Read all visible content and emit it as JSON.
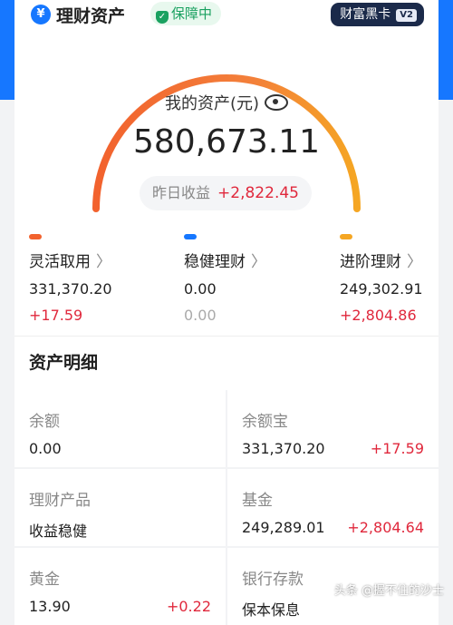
{
  "header": {
    "title": "理财资产",
    "badge": "保障中",
    "vip_label": "财富黑卡",
    "vip_tag": "V2",
    "yen": "¥"
  },
  "summary": {
    "label": "我的资产(元)",
    "amount": "580,673.11",
    "yesterday_label": "昨日收益",
    "yesterday_value": "+2,822.45"
  },
  "categories": [
    {
      "name": "灵活取用",
      "value": "331,370.20",
      "gain": "+17.59",
      "color": "#f2622e"
    },
    {
      "name": "稳健理财",
      "value": "0.00",
      "gain": "0.00",
      "color": "#1677ff"
    },
    {
      "name": "进阶理财",
      "value": "249,302.91",
      "gain": "+2,804.86",
      "color": "#f5a623"
    }
  ],
  "detail": {
    "title": "资产明细",
    "items": [
      {
        "label": "余额",
        "value": "0.00",
        "gain": ""
      },
      {
        "label": "余额宝",
        "value": "331,370.20",
        "gain": "+17.59"
      },
      {
        "label": "理财产品",
        "value": "收益稳健",
        "gain": ""
      },
      {
        "label": "基金",
        "value": "249,289.01",
        "gain": "+2,804.64"
      },
      {
        "label": "黄金",
        "value": "13.90",
        "gain": "+0.22"
      },
      {
        "label": "银行存款",
        "value": "保本保息",
        "gain": ""
      }
    ]
  },
  "watermark": "头条 @握不住的沙士"
}
